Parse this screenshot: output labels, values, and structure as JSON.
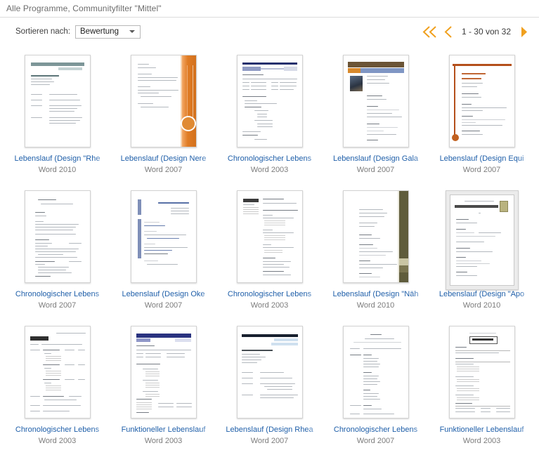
{
  "header": {
    "filter_text": "Alle Programme, Communityfilter \"Mittel\""
  },
  "toolbar": {
    "sort_label": "Sortieren nach:",
    "sort_value": "Bewertung",
    "sort_options": [
      "Bewertung"
    ],
    "caret_icon": "chevron-down-icon"
  },
  "pager": {
    "first_icon": "double-chevron-left-icon",
    "prev_icon": "chevron-left-icon",
    "next_icon": "chevron-right-icon",
    "range_text": "1 - 30 von 32",
    "accent_color": "#f0a01e"
  },
  "colors": {
    "link": "#1f5fa9",
    "subtle": "#7c7c7c",
    "orange": "#f0a01e"
  },
  "items": [
    {
      "title": "Lebenslauf (Design \"Rhe",
      "program": "Word 2010"
    },
    {
      "title": "Lebenslauf (Design Nere",
      "program": "Word 2007"
    },
    {
      "title": "Chronologischer Lebens",
      "program": "Word 2003"
    },
    {
      "title": "Lebenslauf (Design Gala",
      "program": "Word 2007"
    },
    {
      "title": "Lebenslauf (Design Equi",
      "program": "Word 2007"
    },
    {
      "title": "Chronologischer Lebens",
      "program": "Word 2007"
    },
    {
      "title": "Lebenslauf (Design Oke",
      "program": "Word 2007"
    },
    {
      "title": "Chronologischer Lebens",
      "program": "Word 2003"
    },
    {
      "title": "Lebenslauf (Design \"Näh",
      "program": "Word 2010"
    },
    {
      "title": "Lebenslauf (Design \"Apo",
      "program": "Word 2010"
    },
    {
      "title": "Chronologischer Lebens",
      "program": "Word 2003"
    },
    {
      "title": "Funktioneller Lebenslauf",
      "program": "Word 2003"
    },
    {
      "title": "Lebenslauf (Design Rhea",
      "program": "Word 2007"
    },
    {
      "title": "Chronologischer Lebens",
      "program": "Word 2007"
    },
    {
      "title": "Funktioneller Lebenslauf",
      "program": "Word 2003"
    }
  ]
}
